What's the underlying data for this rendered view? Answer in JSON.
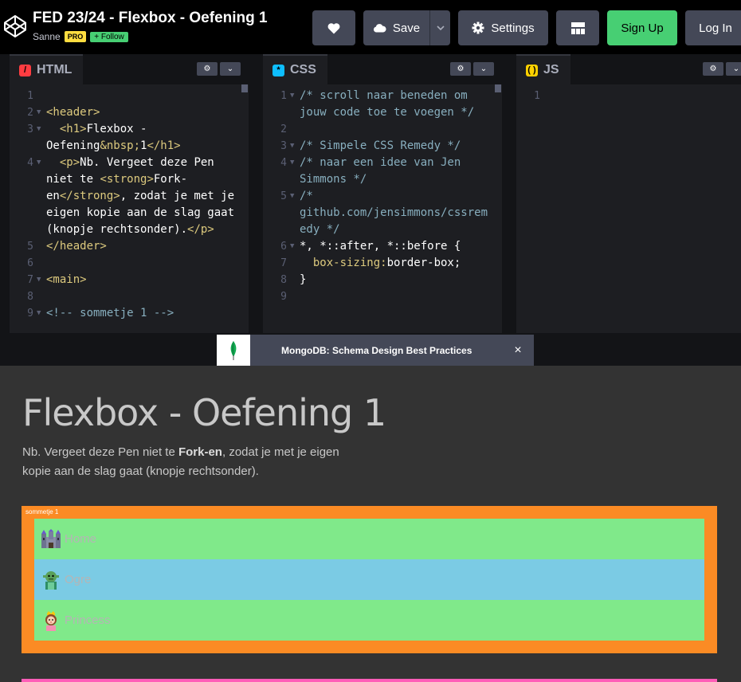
{
  "header": {
    "title": "FED 23/24 - Flexbox - Oefening 1",
    "author": "Sanne",
    "pro_badge": "PRO",
    "follow_label": "+ Follow",
    "save_label": "Save",
    "settings_label": "Settings",
    "signup_label": "Sign Up",
    "login_label": "Log In"
  },
  "panes": {
    "html": {
      "label": "HTML"
    },
    "css": {
      "label": "CSS"
    },
    "js": {
      "label": "JS"
    }
  },
  "html_code": [
    {
      "n": "1",
      "fold": false,
      "segments": []
    },
    {
      "n": "2",
      "fold": true,
      "segments": [
        {
          "t": "<header>",
          "c": "tag"
        }
      ]
    },
    {
      "n": "3",
      "fold": true,
      "segments": [
        {
          "t": "  <h1>",
          "c": "tag"
        },
        {
          "t": "Flexbox - Oefening",
          "c": ""
        },
        {
          "t": "&nbsp;",
          "c": "ent"
        },
        {
          "t": "1",
          "c": ""
        },
        {
          "t": "</h1>",
          "c": "tag"
        }
      ]
    },
    {
      "n": "4",
      "fold": true,
      "segments": [
        {
          "t": "  <p>",
          "c": "tag"
        },
        {
          "t": "Nb. Vergeet deze Pen niet te ",
          "c": ""
        },
        {
          "t": "<strong>",
          "c": "tag"
        },
        {
          "t": "Fork-en",
          "c": ""
        },
        {
          "t": "</strong>",
          "c": "tag"
        },
        {
          "t": ", zodat je met je eigen kopie aan de slag gaat (knopje rechtsonder).",
          "c": ""
        },
        {
          "t": "</p>",
          "c": "tag"
        }
      ]
    },
    {
      "n": "5",
      "fold": false,
      "segments": [
        {
          "t": "</header>",
          "c": "tag"
        }
      ]
    },
    {
      "n": "6",
      "fold": false,
      "segments": []
    },
    {
      "n": "7",
      "fold": true,
      "segments": [
        {
          "t": "<main>",
          "c": "tag"
        }
      ]
    },
    {
      "n": "8",
      "fold": false,
      "segments": []
    },
    {
      "n": "9",
      "fold": true,
      "segments": [
        {
          "t": "<!-- sommetje 1 -->",
          "c": "com"
        }
      ]
    }
  ],
  "css_code": [
    {
      "n": "1",
      "fold": true,
      "segments": [
        {
          "t": "/* scroll naar beneden om jouw code toe te voegen */",
          "c": "com"
        }
      ]
    },
    {
      "n": "2",
      "fold": false,
      "segments": []
    },
    {
      "n": "3",
      "fold": true,
      "segments": [
        {
          "t": "/* Simpele CSS Remedy */",
          "c": "com"
        }
      ]
    },
    {
      "n": "4",
      "fold": true,
      "segments": [
        {
          "t": "/* naar een idee van Jen Simmons */",
          "c": "com"
        }
      ]
    },
    {
      "n": "5",
      "fold": true,
      "segments": [
        {
          "t": "/* github.com/jensimmons/cssremedy */",
          "c": "com"
        }
      ]
    },
    {
      "n": "6",
      "fold": true,
      "segments": [
        {
          "t": "*, *::after, *::before {",
          "c": ""
        }
      ]
    },
    {
      "n": "7",
      "fold": false,
      "segments": [
        {
          "t": "  box-sizing:",
          "c": "prop"
        },
        {
          "t": "border-box;",
          "c": ""
        }
      ]
    },
    {
      "n": "",
      "fold": false,
      "segments": []
    },
    {
      "n": "8",
      "fold": false,
      "segments": [
        {
          "t": "}",
          "c": ""
        }
      ]
    },
    {
      "n": "9",
      "fold": false,
      "segments": []
    }
  ],
  "js_code": [
    {
      "n": "1",
      "fold": false,
      "segments": []
    }
  ],
  "ad": {
    "text": "MongoDB: Schema Design Best Practices",
    "close": "×"
  },
  "preview": {
    "title": "Flexbox - Oefening 1",
    "intro_before": "Nb. Vergeet deze Pen niet te ",
    "intro_strong": "Fork-en",
    "intro_after": ", zodat je met je eigen kopie aan de slag gaat (knopje rechtsonder).",
    "section_label": "sommetje 1",
    "items": [
      {
        "label": "Home",
        "icon": "castle-icon"
      },
      {
        "label": "Ogre",
        "icon": "ogre-icon"
      },
      {
        "label": "Princess",
        "icon": "princess-icon"
      }
    ]
  },
  "colors": {
    "signup": "#47cf73",
    "pro": "#ffdd40",
    "orange": "#fb8b24",
    "green": "#80e98a",
    "blue": "#7bcbe4",
    "pink": "#ff5eb8"
  }
}
